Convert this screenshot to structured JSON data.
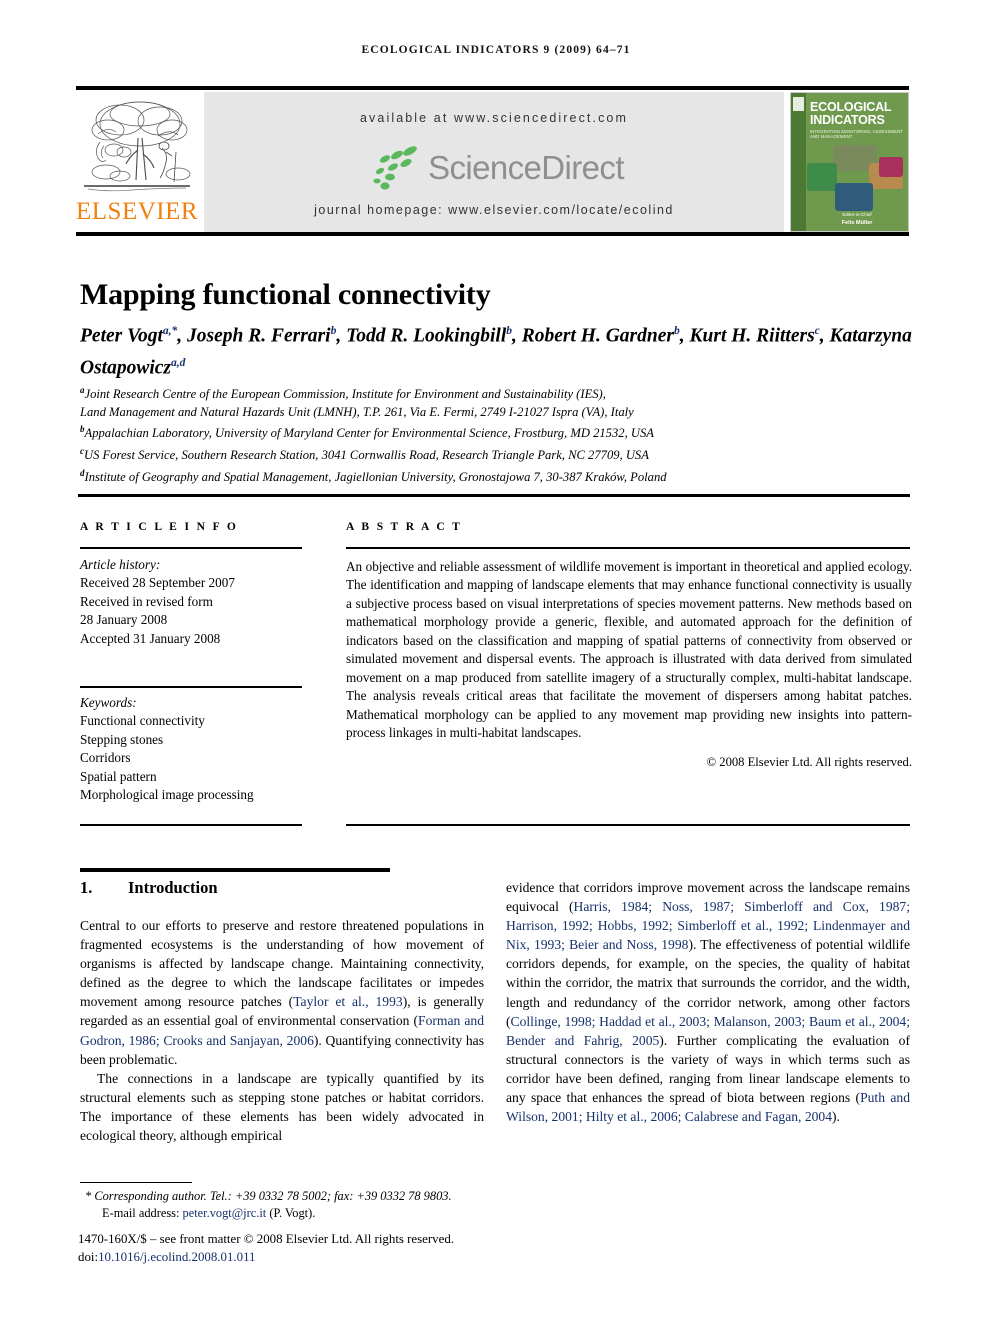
{
  "running_head": "ECOLOGICAL INDICATORS 9 (2009) 64–71",
  "masthead": {
    "publisher_name": "ELSEVIER",
    "publisher_logo_alt": "elsevier-tree-logo",
    "available_at": "available at www.sciencedirect.com",
    "sciencedirect_wordmark": "ScienceDirect",
    "journal_homepage": "journal homepage: www.elsevier.com/locate/ecolind",
    "cover": {
      "title_line1": "ECOLOGICAL",
      "title_line2": "INDICATORS",
      "subtitle": "INTEGRATING MONITORING, ASSESSMENT AND MANAGEMENT",
      "editor_label": "Editor-in-Chief",
      "editor_name": "Felix Müller"
    },
    "colors": {
      "elsevier_orange": "#F08010",
      "sciencedirect_green": "#4fa84f",
      "sciencedirect_grey": "#8f8f8f",
      "band_grey": "#e6e6e6",
      "cover_green": "#6f9a4e"
    }
  },
  "article": {
    "title": "Mapping functional connectivity",
    "authors": [
      {
        "name": "Peter Vogt",
        "sup": "a,*"
      },
      {
        "name": "Joseph R. Ferrari",
        "sup": "b"
      },
      {
        "name": "Todd R. Lookingbill",
        "sup": "b"
      },
      {
        "name": "Robert H. Gardner",
        "sup": "b"
      },
      {
        "name": "Kurt H. Riitters",
        "sup": "c"
      },
      {
        "name": "Katarzyna Ostapowicz",
        "sup": "a,d"
      }
    ],
    "affiliations": [
      {
        "marker": "a",
        "text": "Joint Research Centre of the European Commission, Institute for Environment and Sustainability (IES),"
      },
      {
        "marker": "",
        "text": "Land Management and Natural Hazards Unit (LMNH), T.P. 261, Via E. Fermi, 2749 I-21027 Ispra (VA), Italy"
      },
      {
        "marker": "b",
        "text": "Appalachian Laboratory, University of Maryland Center for Environmental Science, Frostburg, MD 21532, USA"
      },
      {
        "marker": "c",
        "text": "US Forest Service, Southern Research Station, 3041 Cornwallis Road, Research Triangle Park, NC 27709, USA"
      },
      {
        "marker": "d",
        "text": "Institute of Geography and Spatial Management, Jagiellonian University, Gronostajowa 7, 30-387 Kraków, Poland"
      }
    ]
  },
  "article_info": {
    "heading": "A R T I C L E  I N F O",
    "history_label": "Article history:",
    "history": [
      "Received 28 September 2007",
      "Received in revised form",
      "28 January 2008",
      "Accepted 31 January 2008"
    ],
    "keywords_label": "Keywords:",
    "keywords": [
      "Functional connectivity",
      "Stepping stones",
      "Corridors",
      "Spatial pattern",
      "Morphological image processing"
    ]
  },
  "abstract": {
    "heading": "A B S T R A C T",
    "text": "An objective and reliable assessment of wildlife movement is important in theoretical and applied ecology. The identification and mapping of landscape elements that may enhance functional connectivity is usually a subjective process based on visual interpretations of species movement patterns. New methods based on mathematical morphology provide a generic, flexible, and automated approach for the definition of indicators based on the classification and mapping of spatial patterns of connectivity from observed or simulated movement and dispersal events. The approach is illustrated with data derived from simulated movement on a map produced from satellite imagery of a structurally complex, multi-habitat landscape. The analysis reveals critical areas that facilitate the movement of dispersers among habitat patches. Mathematical morphology can be applied to any movement map providing new insights into pattern-process linkages in multi-habitat landscapes.",
    "copyright": "© 2008 Elsevier Ltd. All rights reserved."
  },
  "body": {
    "section_number": "1.",
    "section_title": "Introduction",
    "left_paragraph_1_a": "Central to our efforts to preserve and restore threatened populations in fragmented ecosystems is the understanding of how movement of organisms is affected by landscape change. Maintaining connectivity, defined as the degree to which the landscape facilitates or impedes movement among resource patches (",
    "left_cite_1": "Taylor et al., 1993",
    "left_paragraph_1_b": "), is generally regarded as an essential goal of environmental conservation (",
    "left_cite_2": "Forman and Godron, 1986; Crooks and Sanjayan, 2006",
    "left_paragraph_1_c": "). Quantifying connectivity has been problematic.",
    "left_paragraph_2": "The connections in a landscape are typically quantified by its structural elements such as stepping stone patches or habitat corridors. The importance of these elements has been widely advocated in ecological theory, although empirical",
    "right_paragraph_a": "evidence that corridors improve movement across the landscape remains equivocal (",
    "right_cite_1": "Harris, 1984; Noss, 1987; Simberloff and Cox, 1987; Harrison, 1992; Hobbs, 1992; Simberloff et al., 1992; Lindenmayer and Nix, 1993; Beier and Noss, 1998",
    "right_paragraph_b": "). The effectiveness of potential wildlife corridors depends, for example, on the species, the quality of habitat within the corridor, the matrix that surrounds the corridor, and the width, length and redundancy of the corridor network, among other factors (",
    "right_cite_2": "Collinge, 1998; Haddad et al., 2003; Malanson, 2003; Baum et al., 2004; Bender and Fahrig, 2005",
    "right_paragraph_c": "). Further complicating the evaluation of structural connectors is the variety of ways in which terms such as corridor have been defined, ranging from linear landscape elements to any space that enhances the spread of biota between regions (",
    "right_cite_3": "Puth and Wilson, 2001; Hilty et al., 2006; Calabrese and Fagan, 2004",
    "right_paragraph_d": ")."
  },
  "footnote": {
    "marker": "*",
    "corresponding": "Corresponding author. Tel.: +39 0332 78 5002; fax: +39 0332 78 9803.",
    "email_label": "E-mail address:",
    "email": "peter.vogt@jrc.it",
    "email_owner": "(P. Vogt).",
    "issn_line": "1470-160X/$ – see front matter © 2008 Elsevier Ltd. All rights reserved.",
    "doi_label": "doi:",
    "doi": "10.1016/j.ecolind.2008.01.011"
  }
}
